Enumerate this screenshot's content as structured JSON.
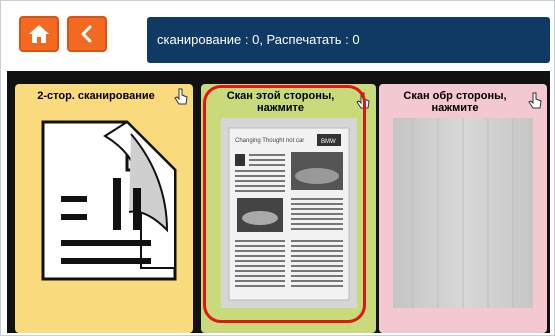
{
  "toolbar": {
    "home_icon": "home-icon",
    "back_icon": "chevron-left-icon",
    "status_text": "сканирование : 0, Распечатать : 0"
  },
  "panels": [
    {
      "title": "2-стор. сканирование",
      "icon": "two-sided-document-icon"
    },
    {
      "title": "Скан этой стороны,\nнажмите",
      "preview_title": "Changing Thought not car",
      "preview_badge": "BMW"
    },
    {
      "title": "Скан обр стороны,\nнажмите"
    }
  ],
  "colors": {
    "accent_orange": "#f26a22",
    "status_bar": "#0f3a63",
    "panel_1": "#f9da7c",
    "panel_2": "#c8da7a",
    "panel_3": "#f4c8d0",
    "highlight": "#e01515"
  }
}
